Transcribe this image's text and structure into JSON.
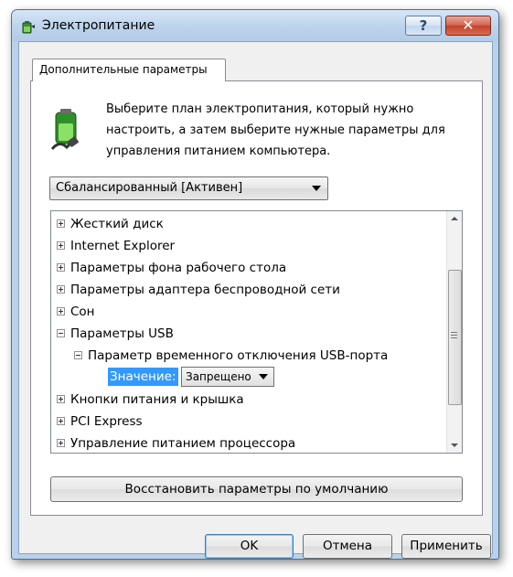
{
  "window": {
    "title": "Электропитание",
    "help_label": "?",
    "close_label": "✕"
  },
  "tab": {
    "label": "Дополнительные параметры"
  },
  "description": "Выберите план электропитания, который нужно настроить, а затем выберите нужные параметры для управления питанием компьютера.",
  "plan_select": {
    "value": "Сбалансированный [Активен]"
  },
  "tree": {
    "items": [
      {
        "label": "Жесткий диск",
        "state": "collapsed"
      },
      {
        "label": "Internet Explorer",
        "state": "collapsed"
      },
      {
        "label": "Параметры фона рабочего стола",
        "state": "collapsed"
      },
      {
        "label": "Параметры адаптера беспроводной сети",
        "state": "collapsed"
      },
      {
        "label": "Сон",
        "state": "collapsed"
      },
      {
        "label": "Параметры USB",
        "state": "expanded"
      },
      {
        "label": "Параметр временного отключения USB-порта",
        "state": "expanded"
      },
      {
        "label": "Кнопки питания и крышка",
        "state": "collapsed"
      },
      {
        "label": "PCI Express",
        "state": "collapsed"
      },
      {
        "label": "Управление питанием процессора",
        "state": "collapsed"
      }
    ],
    "setting": {
      "label": "Значение:",
      "value": "Запрещено"
    }
  },
  "restore_button": "Восстановить параметры по умолчанию",
  "buttons": {
    "ok": "OK",
    "cancel": "Отмена",
    "apply": "Применить"
  },
  "icons": {
    "title": "power-options-icon",
    "battery": "battery-plug-icon"
  },
  "colors": {
    "selection": "#3399ff",
    "titlebar": "#bcd3ec"
  }
}
